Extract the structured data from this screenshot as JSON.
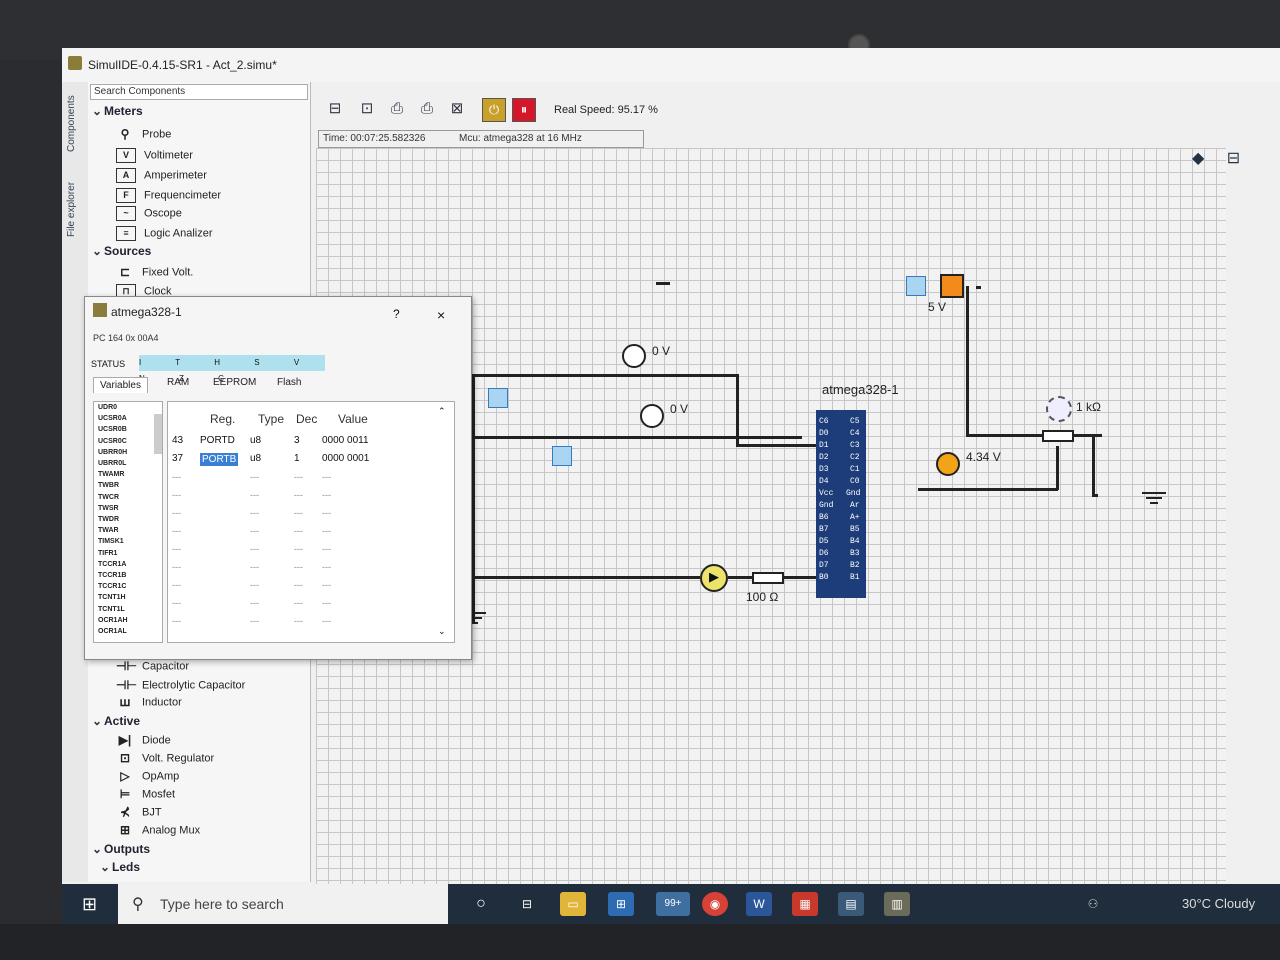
{
  "window": {
    "title": "SimulIDE-0.4.15-SR1  -  Act_2.simu*"
  },
  "side_tabs": {
    "components": "Components",
    "file_explorer": "File explorer"
  },
  "component_panel": {
    "search_placeholder": "Search Components",
    "meters": {
      "label": "Meters",
      "items": [
        "Probe",
        "Voltimeter",
        "Amperimeter",
        "Frequencimeter",
        "Oscope",
        "Logic Analizer"
      ]
    },
    "sources": {
      "label": "Sources",
      "items": [
        "Fixed Volt.",
        "Clock"
      ]
    },
    "passive_items": [
      "Capacitor",
      "Electrolytic Capacitor",
      "Inductor"
    ],
    "active": {
      "label": "Active",
      "items": [
        "Diode",
        "Volt. Regulator",
        "OpAmp",
        "Mosfet",
        "BJT",
        "Analog Mux"
      ]
    },
    "outputs": {
      "label": "Outputs",
      "sub": "Leds"
    }
  },
  "toolbar": {
    "real_speed": "Real Speed: 95.17 %"
  },
  "statusbar": {
    "time": "Time: 00:07:25.582326",
    "mcu": "Mcu: atmega328 at 16 MHz"
  },
  "circuit": {
    "probe1_label": "0 V",
    "probe2_label": "0 V",
    "probe3_label": "4.34 V",
    "supply_label": "5 V",
    "mcu_name": "atmega328-1",
    "pot_label": "1 kΩ",
    "resistor_label": "100 Ω",
    "mcu_left_pins": [
      "C6",
      "D0",
      "D1",
      "D2",
      "D3",
      "D4",
      "Vcc",
      "Gnd",
      "B6",
      "B7",
      "D5",
      "D6",
      "D7",
      "B0"
    ],
    "mcu_right_pins": [
      "C5",
      "C4",
      "C3",
      "C2",
      "C1",
      "C0",
      "Gnd",
      "Ar",
      "A+",
      "B5",
      "B4",
      "B3",
      "B2",
      "B1"
    ]
  },
  "mcu_dialog": {
    "title": "atmega328-1",
    "help": "?",
    "close": "×",
    "pc_text": "PC        164       0x 00A4",
    "status_label": "STATUS",
    "status_bits": "I T H S V N Z C",
    "tabs": [
      "Variables",
      "RAM",
      "EEPROM",
      "Flash"
    ],
    "variables": [
      "UDR0",
      "UCSR0A",
      "UCSR0B",
      "UCSR0C",
      "UBRR0H",
      "UBRR0L",
      "TWAMR",
      "TWBR",
      "TWCR",
      "TWSR",
      "TWDR",
      "TWAR",
      "TIMSK1",
      "TIFR1",
      "TCCR1A",
      "TCCR1B",
      "TCCR1C",
      "TCNT1H",
      "TCNT1L",
      "OCR1AH",
      "OCR1AL"
    ],
    "table_headers": [
      "Reg.",
      "Type",
      "Dec",
      "Value"
    ],
    "rows": [
      {
        "addr": "43",
        "reg": "PORTD",
        "type": "u8",
        "dec": "3",
        "value": "0000 0011"
      },
      {
        "addr": "37",
        "reg": "PORTB",
        "type": "u8",
        "dec": "1",
        "value": "0000 0001"
      }
    ],
    "empty_cell": "---"
  },
  "taskbar": {
    "search_placeholder": "Type here to search",
    "badge": "99+",
    "weather": "30°C  Cloudy"
  },
  "colors": {
    "chip": "#1d3c7a",
    "switch": "#a9d4f2",
    "supply": "#f38a1c",
    "probe_on": "#f2a318",
    "led": "#ebe36a"
  }
}
